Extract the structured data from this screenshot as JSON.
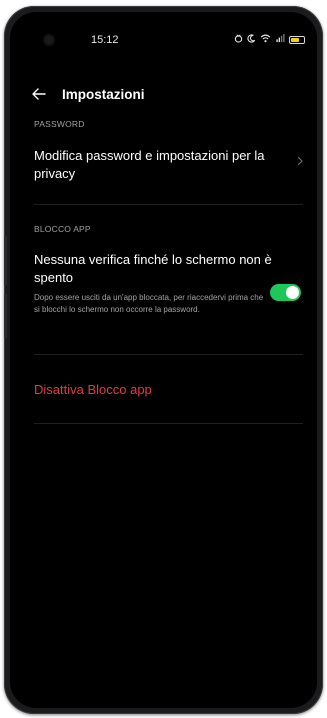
{
  "status_bar": {
    "time": "15:12",
    "icons": [
      "alarm-icon",
      "moon-icon",
      "wifi-icon",
      "signal-icon",
      "battery-icon"
    ],
    "battery_color": "#f2d700"
  },
  "header": {
    "back_icon": "back-arrow-icon",
    "title": "Impostazioni"
  },
  "password_section": {
    "label": "PASSWORD",
    "item_label": "Modifica password e impostazioni per la privacy"
  },
  "app_lock_section": {
    "label": "BLOCCO APP",
    "item_title": "Nessuna verifica finché lo schermo non è spento",
    "item_description": "Dopo essere usciti da un'app bloccata, per riaccedervi prima che si blocchi lo schermo non occorre la password.",
    "toggle_on": true,
    "toggle_color": "#1fc75a"
  },
  "disable_action": {
    "label": "Disattiva Blocco app",
    "color": "#e5394a"
  }
}
